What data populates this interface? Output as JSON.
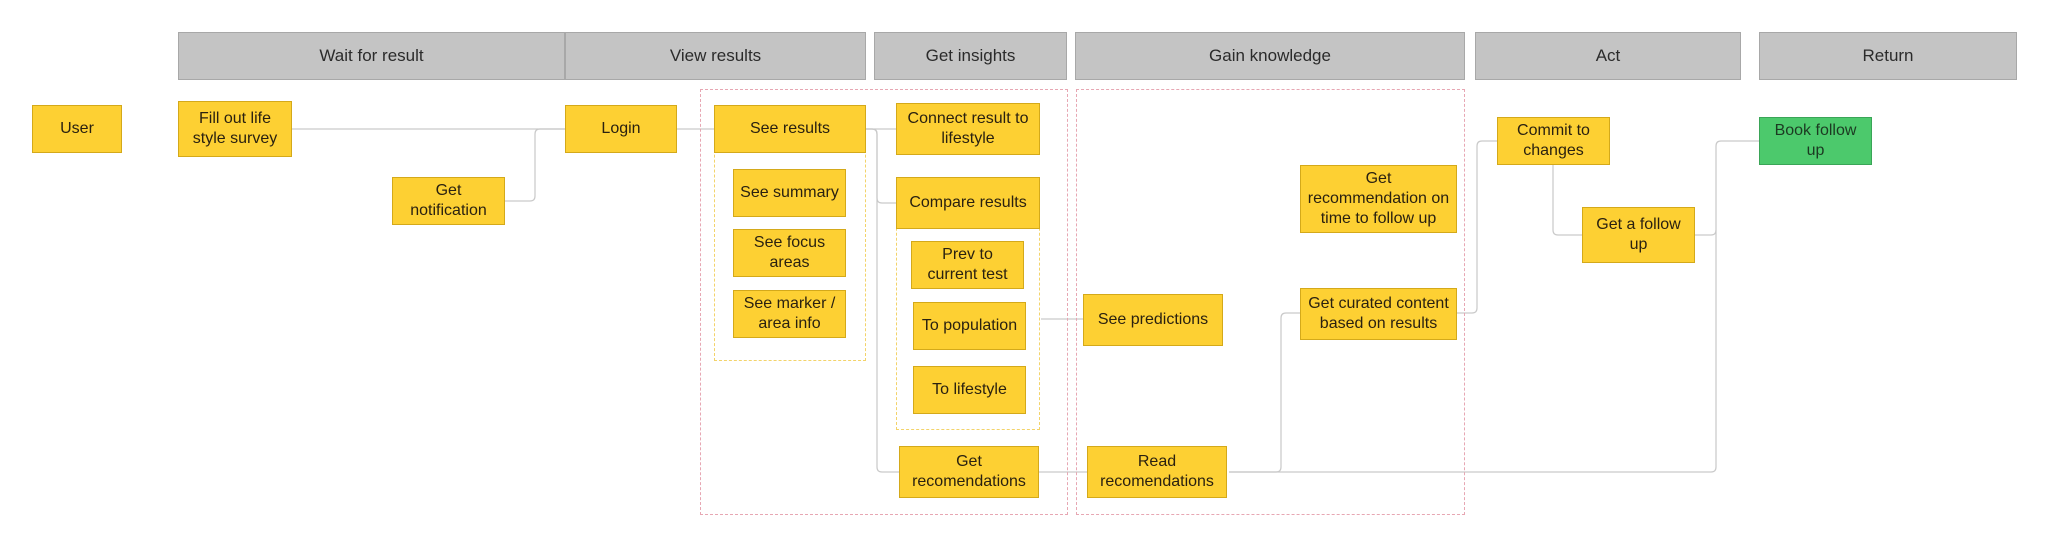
{
  "headers": [
    {
      "label": "Wait for result"
    },
    {
      "label": "View results"
    },
    {
      "label": "Get insights"
    },
    {
      "label": "Gain knowledge"
    },
    {
      "label": "Act"
    },
    {
      "label": "Return"
    }
  ],
  "nodes": {
    "user": "User",
    "fill_survey": "Fill out life style survey",
    "get_notification": "Get notification",
    "login": "Login",
    "see_results": "See results",
    "see_summary": "See summary",
    "see_focus_areas": "See focus areas",
    "see_marker_info": "See marker / area info",
    "connect_result": "Connect result to lifestyle",
    "compare_results": "Compare results",
    "prev_to_current": "Prev to current test",
    "to_population": "To population",
    "to_lifestyle": "To lifestyle",
    "get_recommendations": "Get recomendations",
    "see_predictions": "See predictions",
    "read_recommendations": "Read recomendations",
    "get_recommendation_time": "Get recommendation on time to follow up",
    "get_curated_content": "Get curated content based on results",
    "commit_changes": "Commit to changes",
    "get_follow_up": "Get a follow up",
    "book_follow_up": "Book follow up"
  },
  "colors": {
    "step": "#fdd033",
    "final_step": "#4cc96c",
    "header": "#c4c4c4"
  }
}
